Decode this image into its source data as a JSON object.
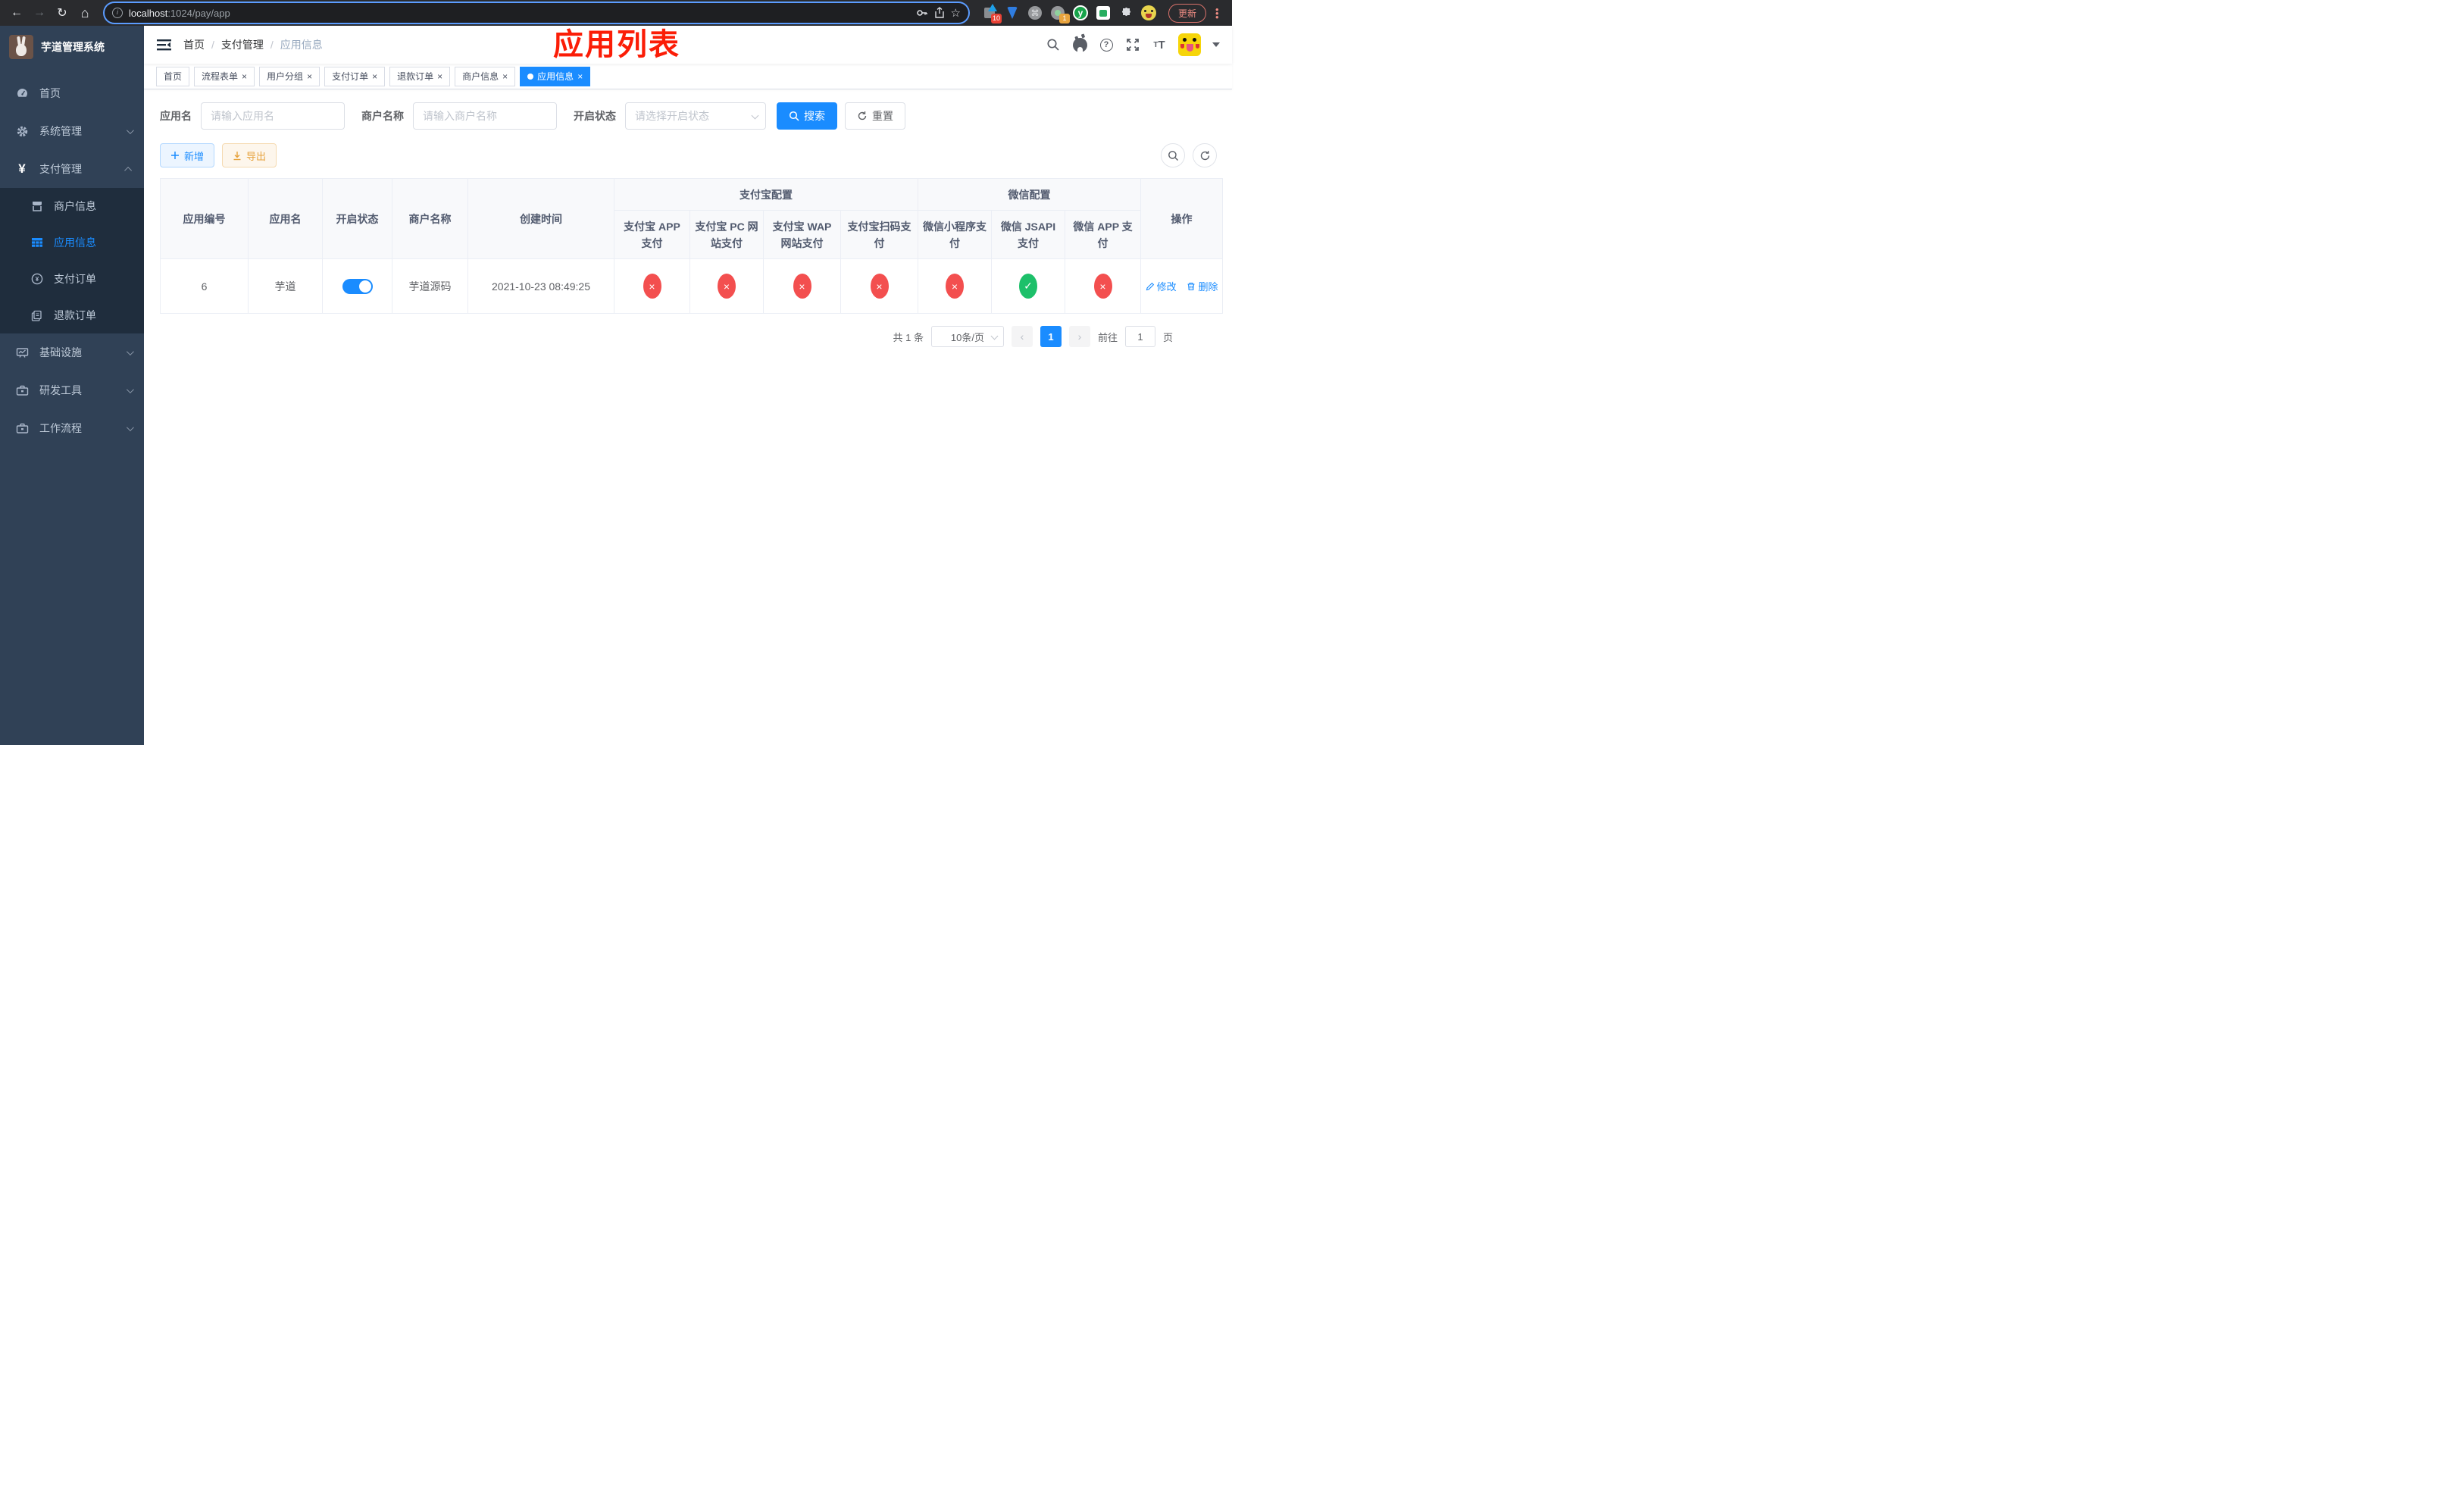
{
  "browser": {
    "url_host": "localhost",
    "url_path": ":1024/pay/app",
    "update_label": "更新",
    "ext_badge_blocks": "10",
    "ext_badge_circle": "1",
    "ext_letter": "y",
    "command_glyph": "⌘",
    "puzzle_glyph": "⬣"
  },
  "sidebar": {
    "title": "芋道管理系统",
    "menu": [
      {
        "label": "首页"
      },
      {
        "label": "系统管理"
      },
      {
        "label": "支付管理"
      },
      {
        "label": "基础设施"
      },
      {
        "label": "研发工具"
      },
      {
        "label": "工作流程"
      }
    ],
    "submenu": [
      {
        "label": "商户信息"
      },
      {
        "label": "应用信息"
      },
      {
        "label": "支付订单"
      },
      {
        "label": "退款订单"
      }
    ],
    "yen_glyph": "¥"
  },
  "navbar": {
    "breadcrumb": [
      "首页",
      "支付管理",
      "应用信息"
    ],
    "separator": "/"
  },
  "annotation": "应用列表",
  "tabs": [
    {
      "label": "首页"
    },
    {
      "label": "流程表单",
      "close": "×"
    },
    {
      "label": "用户分组",
      "close": "×"
    },
    {
      "label": "支付订单",
      "close": "×"
    },
    {
      "label": "退款订单",
      "close": "×"
    },
    {
      "label": "商户信息",
      "close": "×"
    },
    {
      "label": "应用信息",
      "close": "×"
    }
  ],
  "filters": {
    "app_name_label": "应用名",
    "app_name_placeholder": "请输入应用名",
    "merchant_label": "商户名称",
    "merchant_placeholder": "请输入商户名称",
    "status_label": "开启状态",
    "status_placeholder": "请选择开启状态",
    "search_label": "搜索",
    "reset_label": "重置"
  },
  "toolbar": {
    "add_label": "新增",
    "export_label": "导出"
  },
  "table": {
    "groups": {
      "alipay": "支付宝配置",
      "wechat": "微信配置"
    },
    "columns": {
      "id": "应用编号",
      "name": "应用名",
      "status": "开启状态",
      "merchant": "商户名称",
      "created": "创建时间",
      "alipay_app": "支付宝 APP 支付",
      "alipay_pc": "支付宝 PC 网站支付",
      "alipay_wap": "支付宝 WAP 网站支付",
      "alipay_qr": "支付宝扫码支付",
      "wx_mini": "微信小程序支付",
      "wx_jsapi": "微信 JSAPI 支付",
      "wx_app": "微信 APP 支付",
      "ops": "操作"
    },
    "row": {
      "id": "6",
      "name": "芋道",
      "merchant": "芋道源码",
      "created": "2021-10-23 08:49:25",
      "payments": [
        {
          "state": "off",
          "glyph": "×"
        },
        {
          "state": "off",
          "glyph": "×"
        },
        {
          "state": "off",
          "glyph": "×"
        },
        {
          "state": "off",
          "glyph": "×"
        },
        {
          "state": "off",
          "glyph": "×"
        },
        {
          "state": "on",
          "glyph": "✓"
        },
        {
          "state": "off",
          "glyph": "×"
        }
      ],
      "edit_label": "修改",
      "delete_label": "删除"
    }
  },
  "pagination": {
    "total_label": "共 1 条",
    "page_size": "10条/页",
    "prev_glyph": "‹",
    "current_page": "1",
    "next_glyph": "›",
    "goto_label": "前往",
    "goto_value": "1",
    "unit_label": "页"
  },
  "theme": {
    "accent": "#1a8cff",
    "danger": "#f34f4f",
    "success": "#1dc06a",
    "warning": "#e6a23c",
    "sidebar_bg": "#304156",
    "submenu_bg": "#1f2d3d"
  }
}
